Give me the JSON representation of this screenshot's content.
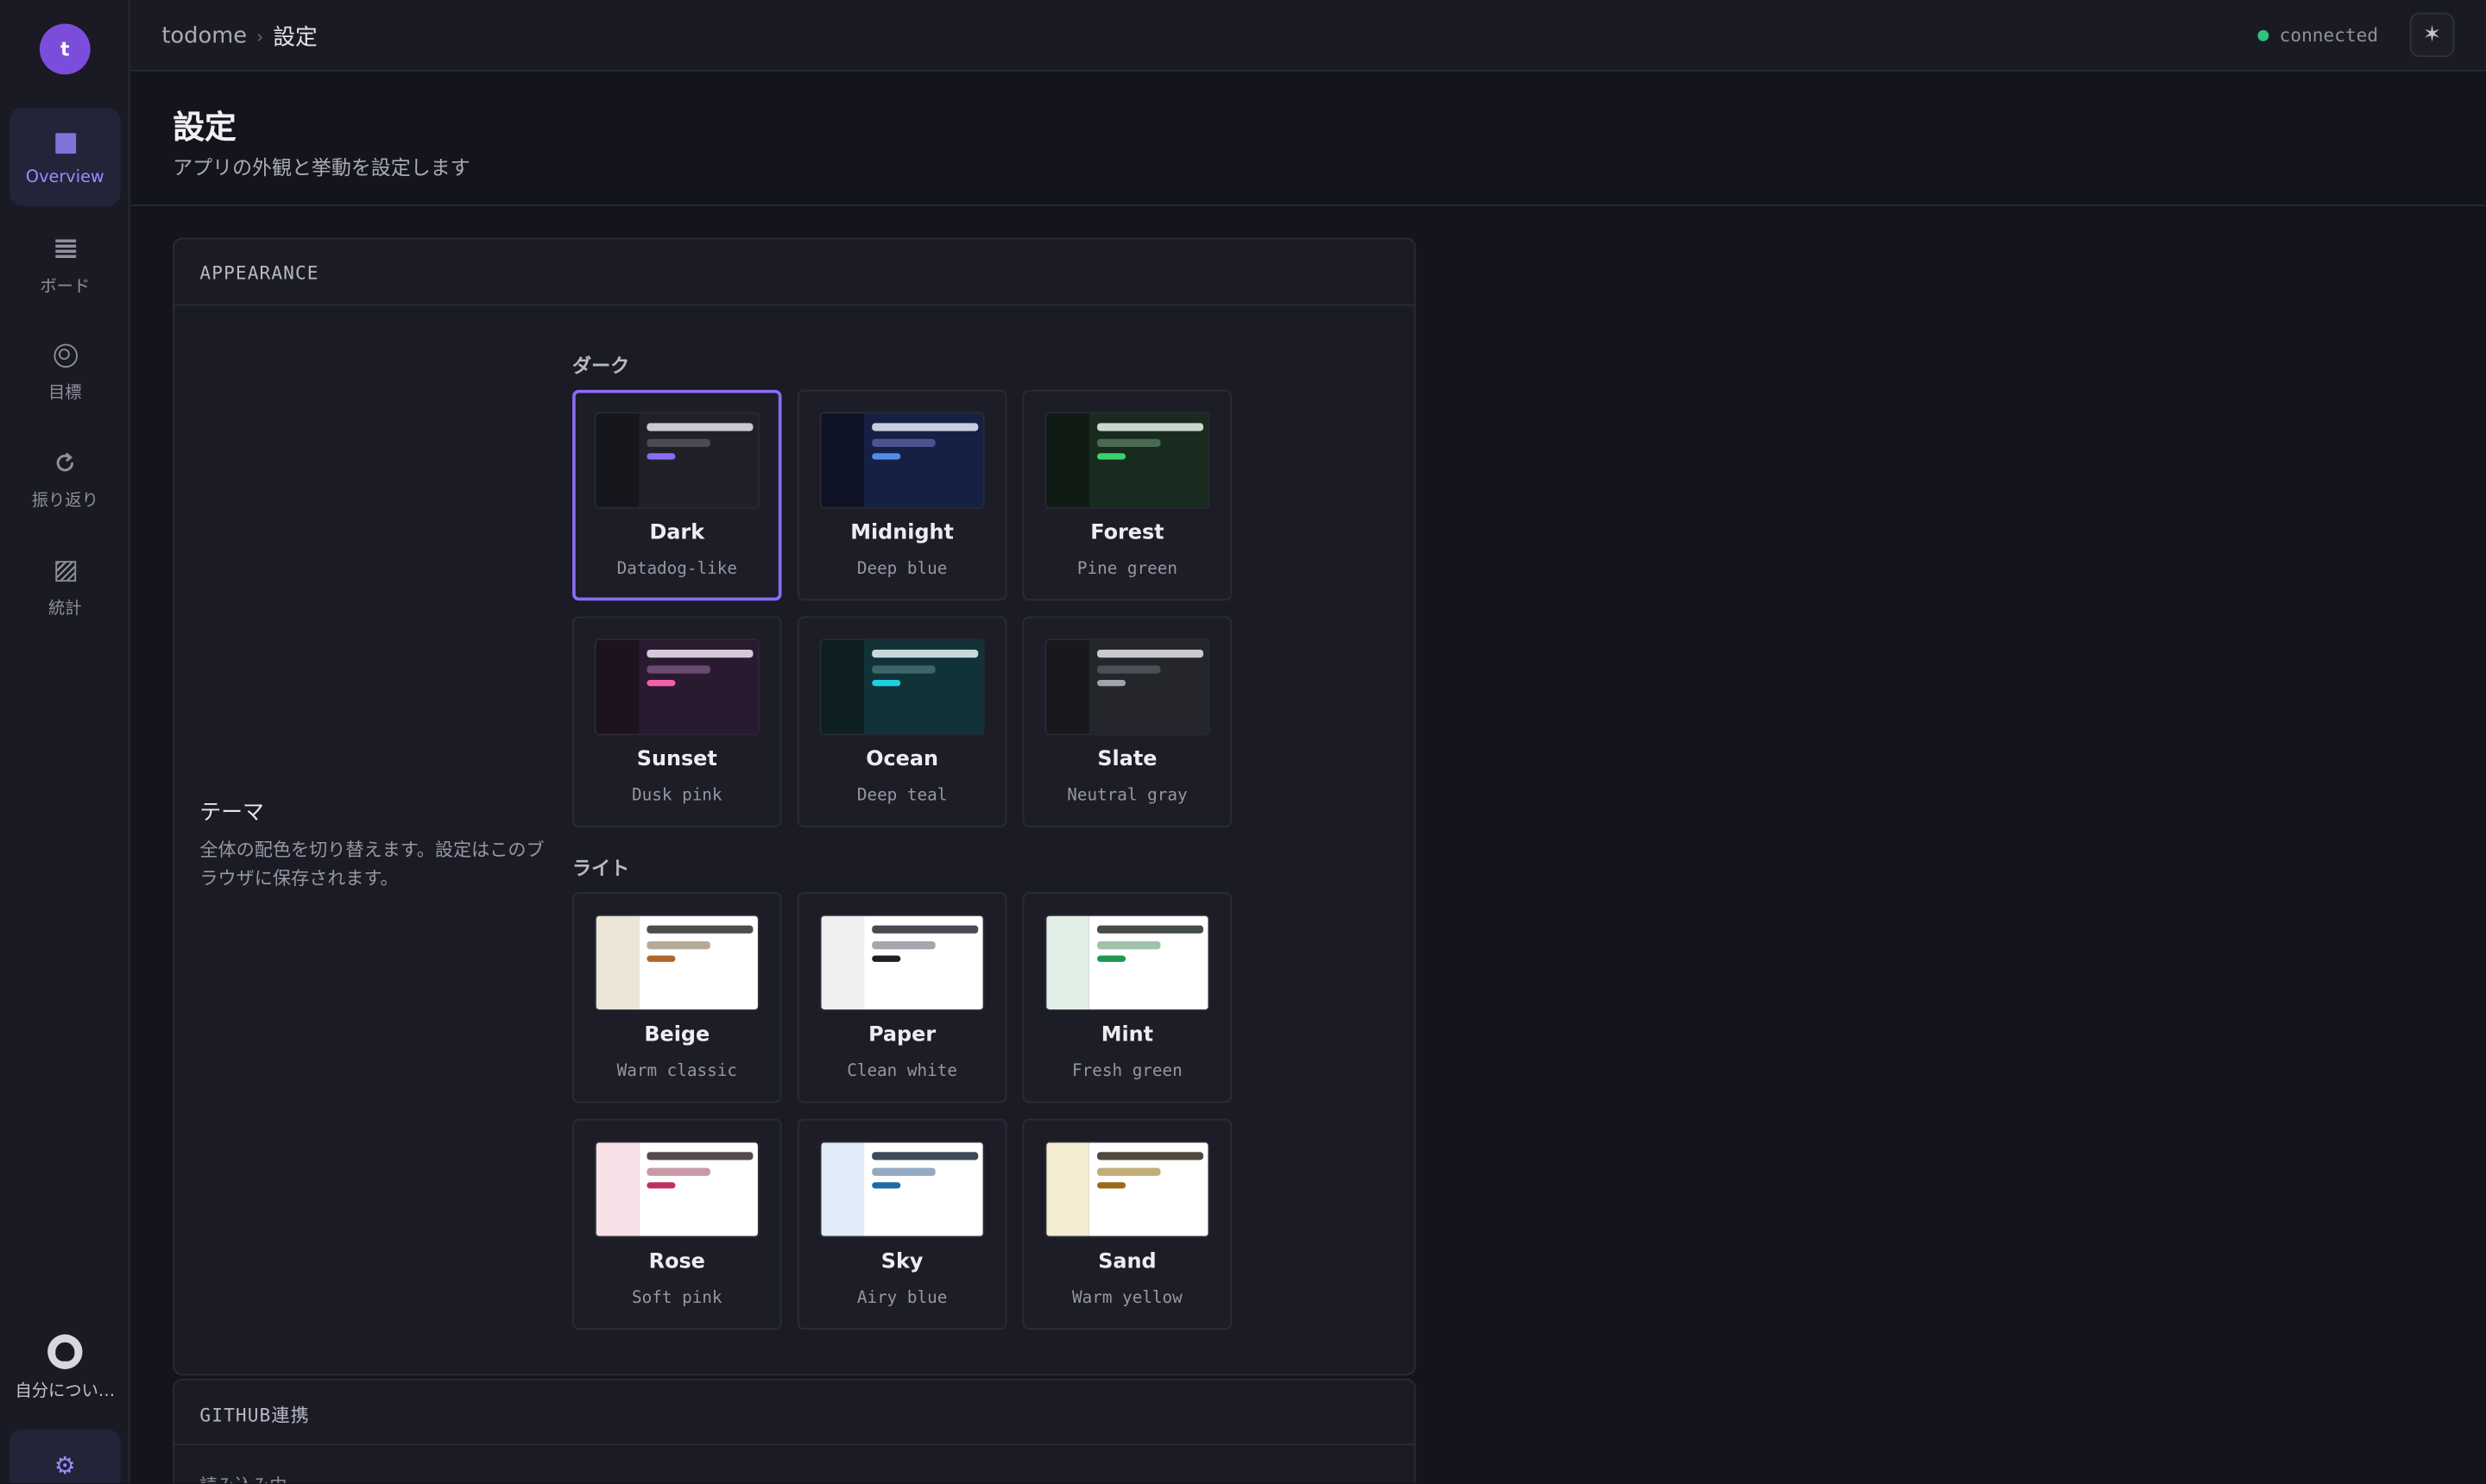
{
  "sidebar": {
    "avatar_letter": "t",
    "items": [
      {
        "label": "Overview",
        "icon": "overview-icon"
      },
      {
        "label": "ボード",
        "icon": "board-icon"
      },
      {
        "label": "目標",
        "icon": "target-icon"
      },
      {
        "label": "振り返り",
        "icon": "refresh-icon"
      },
      {
        "label": "統計",
        "icon": "stats-icon"
      }
    ],
    "about_label": "自分につい…",
    "settings_icon": "⚙"
  },
  "topbar": {
    "app": "todome",
    "separator": "›",
    "current": "設定",
    "status": "connected",
    "status_color": "#2ec27e",
    "theme_button_icon": "✶"
  },
  "page": {
    "title": "設定",
    "subtitle": "アプリの外観と挙動を設定します"
  },
  "appearance": {
    "header": "APPEARANCE",
    "setting_title": "テーマ",
    "setting_desc": "全体の配色を切り替えます。設定はこのブラウザに保存されます。",
    "dark_group": "ダーク",
    "light_group": "ライト",
    "selected": "Dark",
    "accent": "#8b6cf6",
    "themes": [
      {
        "name": "Dark",
        "desc": "Datadog-like",
        "side": "#15161c",
        "main": "#202128",
        "bar1": "#c9c9d1",
        "bar2": "#4a4b55",
        "bar3": "#8b6cf6"
      },
      {
        "name": "Midnight",
        "desc": "Deep blue",
        "side": "#0e1326",
        "main": "#162044",
        "bar1": "#c8cde2",
        "bar2": "#4a5590",
        "bar3": "#4f8de8"
      },
      {
        "name": "Forest",
        "desc": "Pine green",
        "side": "#0f1a13",
        "main": "#182b1e",
        "bar1": "#c9d6cc",
        "bar2": "#4a6a52",
        "bar3": "#3bd16f"
      },
      {
        "name": "Sunset",
        "desc": "Dusk pink",
        "side": "#1c1220",
        "main": "#2a1a30",
        "bar1": "#d6c9da",
        "bar2": "#6a4a72",
        "bar3": "#f062a5"
      },
      {
        "name": "Ocean",
        "desc": "Deep teal",
        "side": "#0d1f22",
        "main": "#113338",
        "bar1": "#c6d8da",
        "bar2": "#3d6468",
        "bar3": "#1fd0e0"
      },
      {
        "name": "Slate",
        "desc": "Neutral gray",
        "side": "#18191d",
        "main": "#24262b",
        "bar1": "#c9cace",
        "bar2": "#4d4f56",
        "bar3": "#a2a4ab"
      },
      {
        "name": "Beige",
        "desc": "Warm classic",
        "side": "#ebe5d8",
        "main": "#ffffff",
        "bar1": "#4d4d4d",
        "bar2": "#b8aa98",
        "bar3": "#b0662a"
      },
      {
        "name": "Paper",
        "desc": "Clean white",
        "side": "#efefef",
        "main": "#ffffff",
        "bar1": "#4a4a52",
        "bar2": "#a4a6ae",
        "bar3": "#1e1e24"
      },
      {
        "name": "Mint",
        "desc": "Fresh green",
        "side": "#e2efe7",
        "main": "#ffffff",
        "bar1": "#464c48",
        "bar2": "#9fc2aa",
        "bar3": "#1e9a4f"
      },
      {
        "name": "Rose",
        "desc": "Soft pink",
        "side": "#f8e1e6",
        "main": "#ffffff",
        "bar1": "#554a4e",
        "bar2": "#c99aa6",
        "bar3": "#c0305e"
      },
      {
        "name": "Sky",
        "desc": "Airy blue",
        "side": "#e0ecf8",
        "main": "#ffffff",
        "bar1": "#3f4a56",
        "bar2": "#93aac2",
        "bar3": "#1d6aa8"
      },
      {
        "name": "Sand",
        "desc": "Warm yellow",
        "side": "#f5edd2",
        "main": "#ffffff",
        "bar1": "#4f4a3e",
        "bar2": "#c2ae78",
        "bar3": "#9a6a1e"
      }
    ]
  },
  "github": {
    "header": "GITHUB連携",
    "loading": "読み込み中..."
  }
}
